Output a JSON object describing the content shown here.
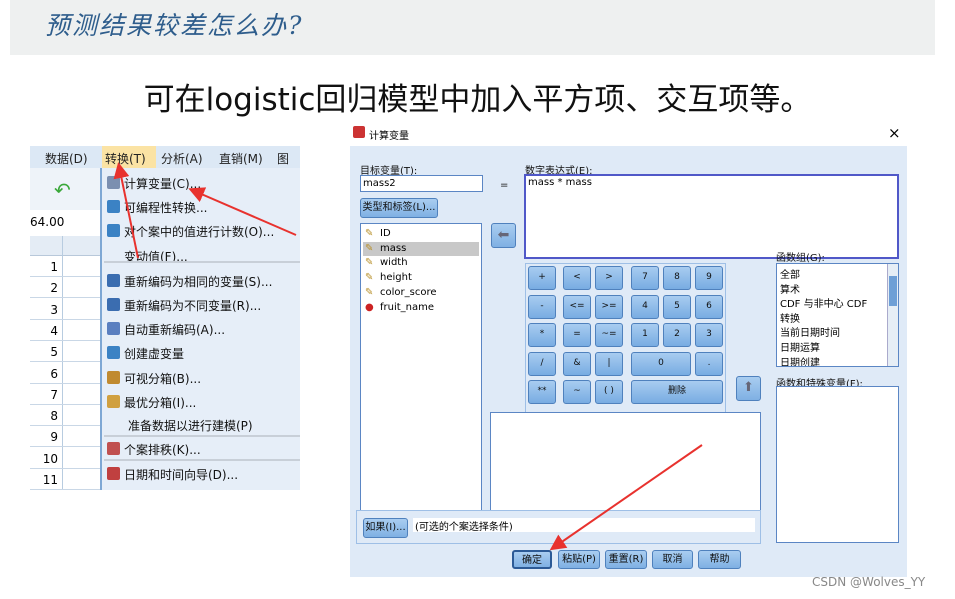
{
  "slide": {
    "title": "预测结果较差怎么办?",
    "subtitle": "可在logistic回归模型中加入平方项、交互项等。",
    "watermark": "CSDN @Wolves_YY"
  },
  "spss": {
    "menubar": [
      "数据(D)",
      "转换(T)",
      "分析(A)",
      "直销(M)",
      "图形"
    ],
    "cell_value": "64.00",
    "rows": [
      "1",
      "2",
      "3",
      "4",
      "5",
      "6",
      "7",
      "8",
      "9",
      "10",
      "11"
    ],
    "menu": [
      "计算变量(C)...",
      "可编程性转换...",
      "对个案中的值进行计数(O)...",
      "变动值(F)...",
      "重新编码为相同的变量(S)...",
      "重新编码为不同变量(R)...",
      "自动重新编码(A)...",
      "创建虚变量",
      "可视分箱(B)...",
      "最优分箱(I)...",
      "准备数据以进行建模(P)",
      "个案排秩(K)...",
      "日期和时间向导(D)..."
    ]
  },
  "dialog": {
    "title": "计算变量",
    "close": "×",
    "target_label": "目标变量(T):",
    "target_value": "mass2",
    "equals": "=",
    "type_label_button": "类型和标签(L)...",
    "expr_label": "数字表达式(E):",
    "expr_value": "mass * mass",
    "variables": [
      "ID",
      "mass",
      "width",
      "height",
      "color_score",
      "fruit_name"
    ],
    "selected_variable": "mass",
    "keypad": {
      "r0": [
        "+",
        "<",
        ">",
        "7",
        "8",
        "9"
      ],
      "r1": [
        "-",
        "<=",
        ">=",
        "4",
        "5",
        "6"
      ],
      "r2": [
        "*",
        "=",
        "~=",
        "1",
        "2",
        "3"
      ],
      "r3": [
        "/",
        "&",
        "|",
        "0",
        "."
      ],
      "r4": [
        "**",
        "~",
        "( )",
        "删除"
      ]
    },
    "func_group_label": "函数组(G):",
    "func_groups": [
      "全部",
      "算术",
      "CDF 与非中心 CDF",
      "转换",
      "当前日期时间",
      "日期运算",
      "日期创建"
    ],
    "func_vars_label": "函数和特殊变量(F):",
    "if_button": "如果(I)...",
    "if_text": "(可选的个案选择条件)",
    "buttons": [
      "确定",
      "粘贴(P)",
      "重置(R)",
      "取消",
      "帮助"
    ]
  }
}
